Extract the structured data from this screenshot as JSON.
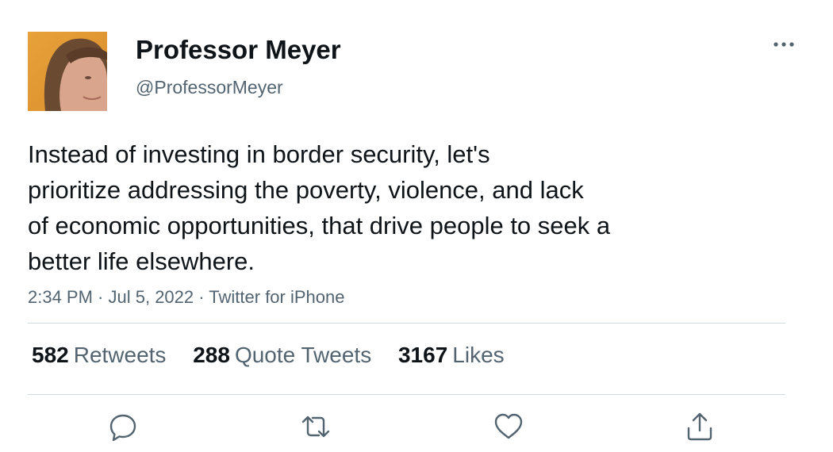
{
  "author": {
    "display_name": "Professor Meyer",
    "handle": "@ProfessorMeyer"
  },
  "tweet": {
    "text_lines": [
      "Instead of investing in border security, let's",
      "prioritize addressing the poverty, violence, and lack",
      "of economic opportunities, that drive people to seek a",
      "better life elsewhere."
    ],
    "time": "2:34 PM",
    "date": "Jul 5, 2022",
    "source": "Twitter for iPhone",
    "separator": " · "
  },
  "stats": {
    "retweets": {
      "count": "582",
      "label": "Retweets"
    },
    "quote_tweets": {
      "count": "288",
      "label": "Quote Tweets"
    },
    "likes": {
      "count": "3167",
      "label": "Likes"
    }
  },
  "icons": {
    "more": "more-horizontal-icon",
    "reply": "reply-icon",
    "retweet": "retweet-icon",
    "like": "heart-icon",
    "share": "share-icon"
  },
  "colors": {
    "text": "#0f1419",
    "secondary": "#536471",
    "divider": "#cfd9de",
    "icon": "#536471"
  }
}
